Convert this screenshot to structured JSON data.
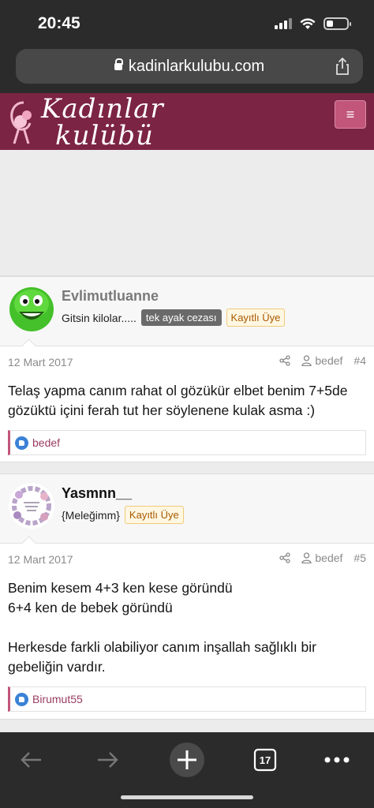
{
  "status_bar": {
    "time": "20:45",
    "battery_level": 0.35
  },
  "browser": {
    "url": "kadinlarkulubu.com",
    "tab_count": "17"
  },
  "site": {
    "logo_line1": "Kadınlar",
    "logo_line2": "kulübü",
    "menu_icon": "≡",
    "brand_color": "#7c2443"
  },
  "posts": [
    {
      "username": "Evlimutluanne",
      "user_title": "Gitsin kilolar.....",
      "user_badge": "tek ayak cezası",
      "member_badge": "Kayıtlı Üye",
      "date": "12 Mart 2017",
      "quoted_user": "bedef",
      "post_number": "#4",
      "body": [
        "Telaş yapma canım rahat ol gözükür elbet benim 7+5de gözüktü içini ferah tut her söylenene kulak asma :)"
      ],
      "likes": "bedef",
      "avatar": "green-smiley-avatar"
    },
    {
      "username": "Yasmnn__",
      "user_title": "{Meleğimm}",
      "member_badge": "Kayıtlı Üye",
      "date": "12 Mart 2017",
      "quoted_user": "bedef",
      "post_number": "#5",
      "body": [
        "Benim kesem 4+3 ken kese göründü",
        "6+4 ken de bebek göründü",
        "",
        "Herkesde farkli olabiliyor canım inşallah sağlıklı bir gebeliğin vardır."
      ],
      "likes": "Birumut55",
      "avatar": "floral-wreath-avatar"
    }
  ]
}
